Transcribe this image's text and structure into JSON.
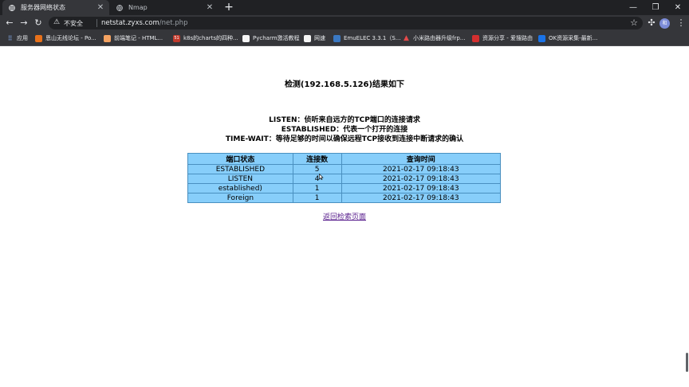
{
  "tabs": [
    {
      "title": "服务器网络状态",
      "active": true
    },
    {
      "title": "Nmap",
      "active": false
    }
  ],
  "window_controls": [
    "—",
    "❐",
    "✕"
  ],
  "address_bar": {
    "security_label": "不安全",
    "host": "netstat.zyxs.com",
    "path": "/net.php"
  },
  "avatar_initial": "和",
  "bookmarks": [
    {
      "label": "应用",
      "icon": "apps-grid-icon",
      "color": "#4285f4"
    },
    {
      "label": "恩山无线论坛 - Po...",
      "icon": "site-favicon",
      "color": "#e8711a"
    },
    {
      "label": "前端笔记 - HTML...",
      "icon": "site-favicon",
      "color": "#f4a261"
    },
    {
      "label": "k8s的charts的四种...",
      "icon": "site-favicon",
      "color": "#c0392b"
    },
    {
      "label": "Pycharm激活教程",
      "icon": "site-favicon",
      "color": "#f5f5f5"
    },
    {
      "label": "网速",
      "icon": "site-favicon",
      "color": "#f5f5f5"
    },
    {
      "label": "EmuELEC 3.3.1（S...",
      "icon": "site-favicon",
      "color": "#3a78c2"
    },
    {
      "label": "小米路由器升级frp...",
      "icon": "site-favicon",
      "color": "#e34a4a"
    },
    {
      "label": "资源分享 - 爱搜路由",
      "icon": "site-favicon",
      "color": "#d32f2f"
    },
    {
      "label": "OK资源采集-最新...",
      "icon": "site-favicon",
      "color": "#1a73e8"
    }
  ],
  "page": {
    "heading": "检测(192.168.5.126)结果如下",
    "legend": [
      "LISTEN：侦听来自远方的TCP端口的连接请求",
      "ESTABLISHED：代表一个打开的连接",
      "TIME-WAIT：等待足够的时间以确保远程TCP接收到连接中断请求的确认"
    ],
    "table": {
      "headers": [
        "端口状态",
        "连接数",
        "查询时间"
      ],
      "rows": [
        [
          "ESTABLISHED",
          "5",
          "2021-02-17 09:18:43"
        ],
        [
          "LISTEN",
          "4",
          "2021-02-17 09:18:43"
        ],
        [
          "established)",
          "1",
          "2021-02-17 09:18:43"
        ],
        [
          "Foreign",
          "1",
          "2021-02-17 09:18:43"
        ]
      ]
    },
    "back_link": "返回检索页面"
  }
}
